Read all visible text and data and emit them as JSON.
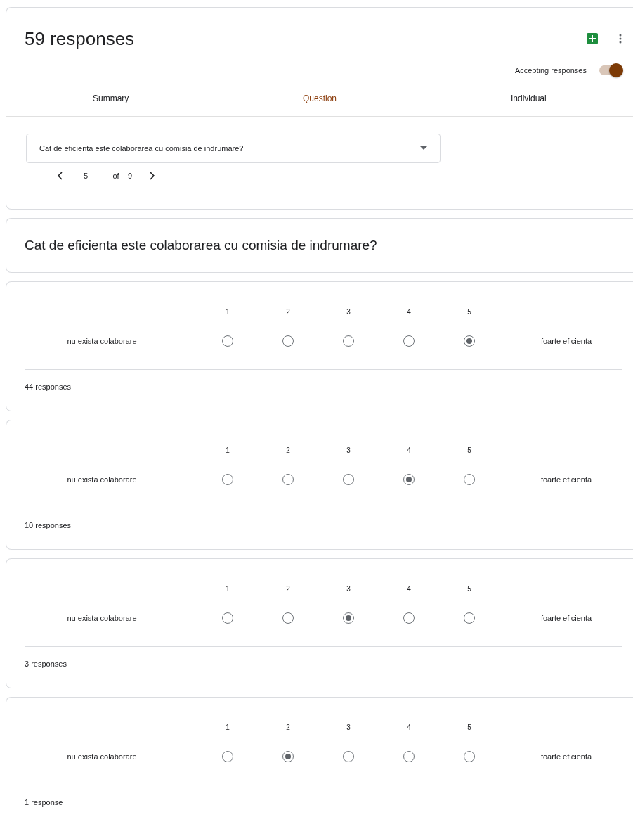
{
  "header": {
    "title": "59 responses",
    "accepting": {
      "label": "Accepting responses",
      "on": true
    }
  },
  "tabs": [
    {
      "label": "Summary",
      "selected": false
    },
    {
      "label": "Question",
      "selected": true
    },
    {
      "label": "Individual",
      "selected": false
    }
  ],
  "question_select": {
    "value": "Cat de eficienta este colaborarea cu comisia de indrumare?"
  },
  "pager": {
    "current": "5",
    "of": "of",
    "total": "9"
  },
  "question_title": "Cat de eficienta este colaborarea cu comisia de indrumare?",
  "responses": [
    {
      "left_label": "nu exista colaborare",
      "right_label": "foarte eficienta",
      "count": "44 responses",
      "options": [
        {
          "label": "1",
          "selected": false
        },
        {
          "label": "2",
          "selected": false
        },
        {
          "label": "3",
          "selected": false
        },
        {
          "label": "4",
          "selected": false
        },
        {
          "label": "5",
          "selected": true
        }
      ]
    },
    {
      "left_label": "nu exista colaborare",
      "right_label": "foarte eficienta",
      "count": "10 responses",
      "options": [
        {
          "label": "1",
          "selected": false
        },
        {
          "label": "2",
          "selected": false
        },
        {
          "label": "3",
          "selected": false
        },
        {
          "label": "4",
          "selected": true
        },
        {
          "label": "5",
          "selected": false
        }
      ]
    },
    {
      "left_label": "nu exista colaborare",
      "right_label": "foarte eficienta",
      "count": "3 responses",
      "options": [
        {
          "label": "1",
          "selected": false
        },
        {
          "label": "2",
          "selected": false
        },
        {
          "label": "3",
          "selected": true
        },
        {
          "label": "4",
          "selected": false
        },
        {
          "label": "5",
          "selected": false
        }
      ]
    },
    {
      "left_label": "nu exista colaborare",
      "right_label": "foarte eficienta",
      "count": "1 response",
      "options": [
        {
          "label": "1",
          "selected": false
        },
        {
          "label": "2",
          "selected": true
        },
        {
          "label": "3",
          "selected": false
        },
        {
          "label": "4",
          "selected": false
        },
        {
          "label": "5",
          "selected": false
        }
      ]
    }
  ]
}
